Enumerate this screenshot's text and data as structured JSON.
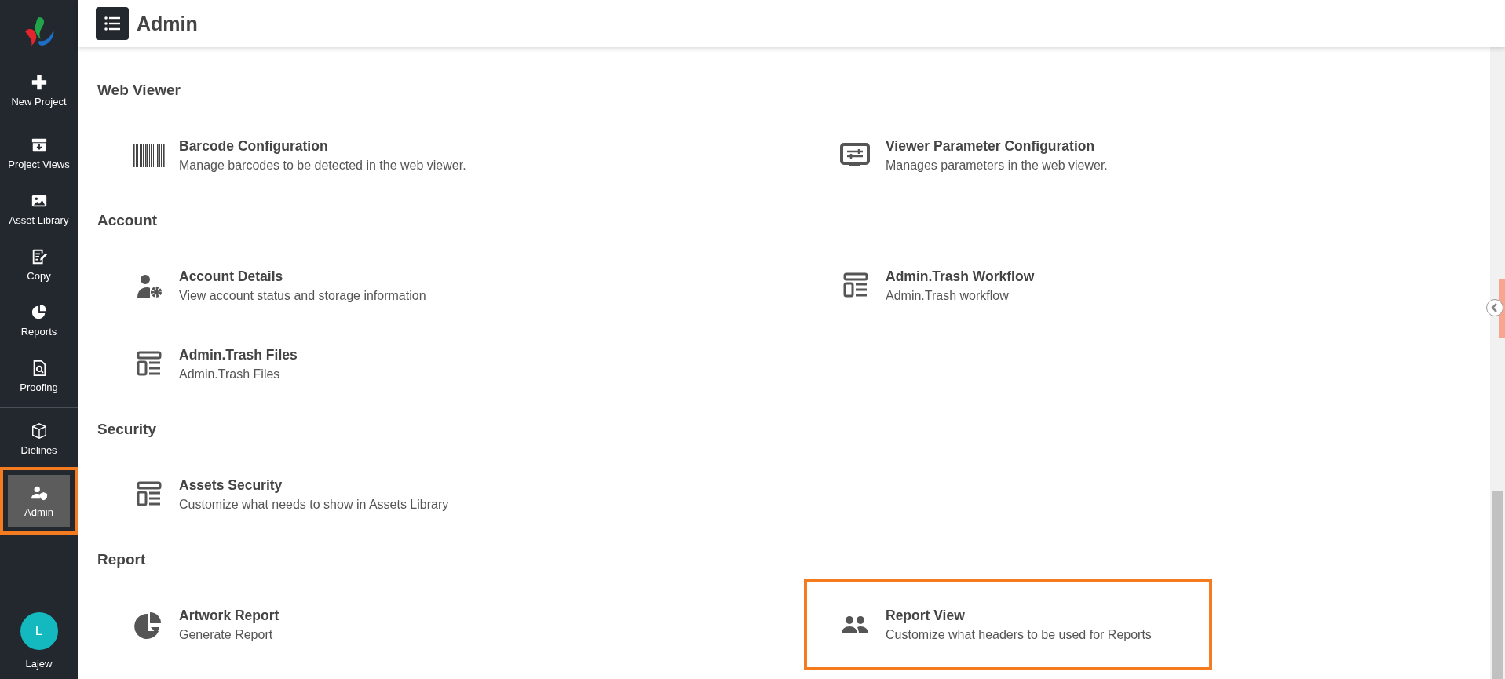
{
  "sidebar": {
    "groups": [
      [
        {
          "label": "New Project",
          "kind": "plus",
          "selected": false,
          "highlighted": false
        }
      ],
      [
        {
          "label": "Project Views",
          "kind": "archive",
          "selected": false,
          "highlighted": false
        },
        {
          "label": "Asset Library",
          "kind": "image",
          "selected": false,
          "highlighted": false
        },
        {
          "label": "Copy",
          "kind": "edit",
          "selected": false,
          "highlighted": false
        },
        {
          "label": "Reports",
          "kind": "pie",
          "selected": false,
          "highlighted": false
        },
        {
          "label": "Proofing",
          "kind": "doc-search",
          "selected": false,
          "highlighted": false
        }
      ],
      [
        {
          "label": "Dielines",
          "kind": "box",
          "selected": false,
          "highlighted": false
        },
        {
          "label": "Admin",
          "kind": "user-shield",
          "selected": true,
          "highlighted": true
        }
      ]
    ],
    "user": {
      "initial": "L",
      "name": "Lajew"
    }
  },
  "header": {
    "title": "Admin"
  },
  "sections": [
    {
      "title": "Web Viewer",
      "items": [
        {
          "title": "Barcode Configuration",
          "description": "Manage barcodes to be detected in the web viewer.",
          "kind": "barcode",
          "highlighted": false
        },
        {
          "title": "Viewer Parameter Configuration",
          "description": "Manages parameters in the web viewer.",
          "kind": "monitor",
          "highlighted": false
        }
      ]
    },
    {
      "title": "Account",
      "items": [
        {
          "title": "Account Details",
          "description": "View account status and storage information",
          "kind": "user-gear",
          "highlighted": false
        },
        {
          "title": "Admin.Trash Workflow",
          "description": "Admin.Trash workflow",
          "kind": "layout",
          "highlighted": false
        },
        {
          "title": "Admin.Trash Files",
          "description": "Admin.Trash Files",
          "kind": "layout",
          "highlighted": false
        }
      ]
    },
    {
      "title": "Security",
      "items": [
        {
          "title": "Assets Security",
          "description": "Customize what needs to show in Assets Library",
          "kind": "layout",
          "highlighted": false
        }
      ]
    },
    {
      "title": "Report",
      "items": [
        {
          "title": "Artwork Report",
          "description": "Generate Report",
          "kind": "pie",
          "highlighted": false
        },
        {
          "title": "Report View",
          "description": "Customize what headers to be used for Reports",
          "kind": "users",
          "highlighted": true
        }
      ]
    }
  ]
}
